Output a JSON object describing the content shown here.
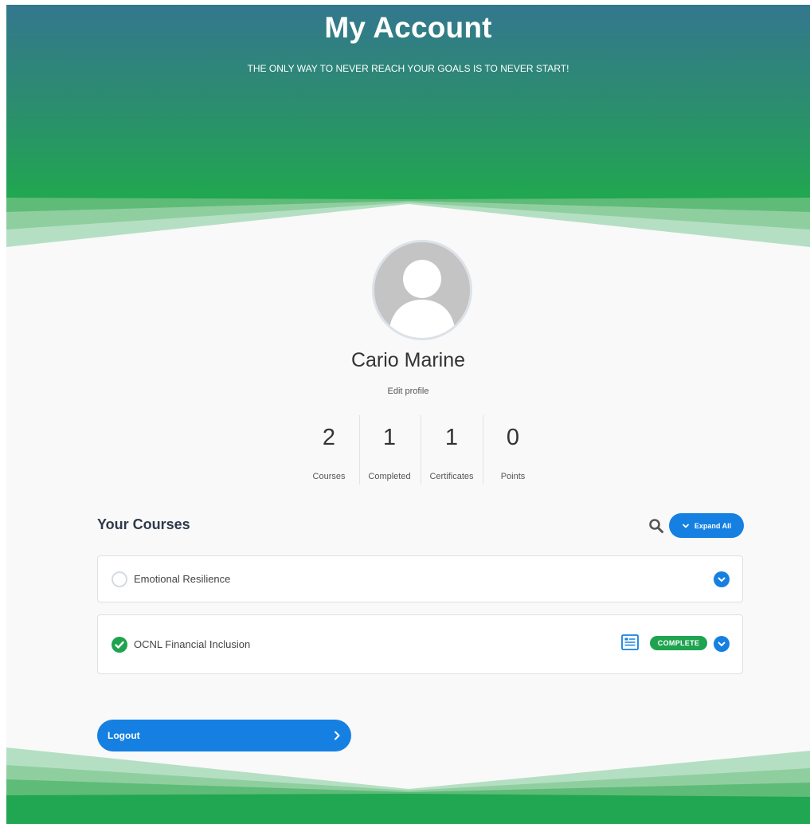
{
  "header": {
    "title": "My Account",
    "tagline": "THE ONLY WAY TO NEVER REACH YOUR GOALS IS TO NEVER START!"
  },
  "profile": {
    "name": "Cario Marine",
    "edit_label": "Edit profile",
    "avatar_icon": "user-silhouette-icon"
  },
  "stats": [
    {
      "value": "2",
      "label": "Courses"
    },
    {
      "value": "1",
      "label": "Completed"
    },
    {
      "value": "1",
      "label": "Certificates"
    },
    {
      "value": "0",
      "label": "Points"
    }
  ],
  "courses_section": {
    "title": "Your Courses",
    "expand_label": "Expand All",
    "search_icon": "search-icon"
  },
  "courses": [
    {
      "title": "Emotional Resilience",
      "status": "not-started"
    },
    {
      "title": "OCNL Financial Inclusion",
      "status": "complete",
      "badge": "COMPLETE",
      "certificate_icon": "certificate-icon"
    }
  ],
  "logout": {
    "label": "Logout"
  },
  "colors": {
    "header_top": "#33778e",
    "header_green": "#21a651",
    "primary_blue": "#1580e1",
    "complete_green": "#1fa34f",
    "page_bg": "#f9f9f9"
  }
}
